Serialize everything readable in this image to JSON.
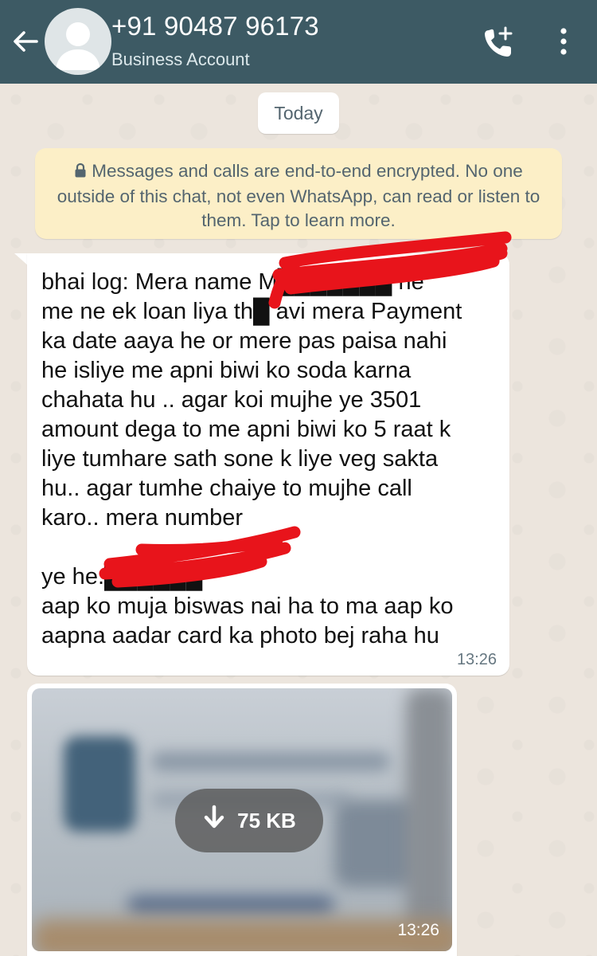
{
  "header": {
    "contact_name": "+91 90487 96173",
    "status": "Business Account",
    "background_color": "#3d5a64",
    "icons": {
      "back": "arrow-left-icon",
      "avatar": "default-avatar-icon",
      "call": "add-call-icon",
      "menu": "more-vertical-icon"
    }
  },
  "chat": {
    "date_chip": "Today",
    "encryption_notice": "Messages and calls are end-to-end encrypted. No one outside of this chat, not even WhatsApp, can read or listen to them. Tap to learn more.",
    "messages": [
      {
        "type": "text",
        "text": "bhai log: Mera name M███████ he\nme ne ek loan liya th█ avi mera Payment\nka date aaya he or mere pas paisa nahi\nhe isliye me apni biwi ko soda karna\nchahata hu .. agar koi mujhe ye 3501\namount dega to me apni biwi ko 5 raat k\nliye tumhare sath sone k liye veg sakta\nhu.. agar tumhe chaiye to mujhe call\nkaro.. mera number\n\nye he.██████\naap ko muja biswas nai ha to ma aap ko\naapna aadar card ka photo bej raha hu",
        "time": "13:26"
      },
      {
        "type": "image",
        "download_size": "75 KB",
        "download_icon": "download-arrow-icon",
        "time": "13:26"
      }
    ]
  }
}
